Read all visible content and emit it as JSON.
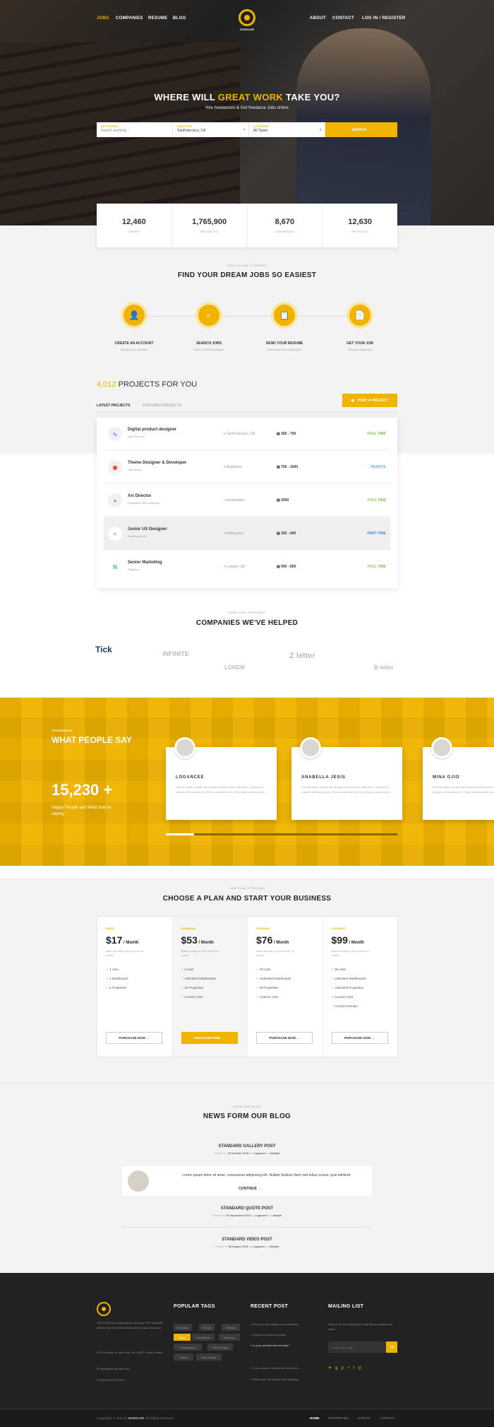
{
  "nav": {
    "items": [
      "JOBS",
      "COMPANIES",
      "RESUME",
      "BLOG"
    ],
    "right": [
      "ABOUT",
      "CONTACT",
      "LOG IN / REGISTER"
    ],
    "logo": "SCHOLAR"
  },
  "hero": {
    "title_a": "WHERE WILL ",
    "title_b": "GREAT WORK",
    "title_c": " TAKE YOU?",
    "subtitle": "Hire freelancers & Get freelance Jobs online"
  },
  "search": {
    "kw_label": "KEY WORDS",
    "kw_placeholder": "Search anything....",
    "loc_label": "LOCATION",
    "loc_value": "SanFrancisco, CA",
    "cat_label": "CATEGORY",
    "cat_value": "All Types",
    "button": "SEARCH →"
  },
  "stats": [
    {
      "value": "12,460",
      "label": "USERS"
    },
    {
      "value": "1,765,900",
      "label": "PROJECTS"
    },
    {
      "value": "8,670",
      "label": "COMPANIES"
    },
    {
      "value": "12,630",
      "label": "PROFILES"
    }
  ],
  "how": {
    "small": "THIS IS HOW IT WORKS",
    "title": "FIND YOUR DREAM JOBS SO EASIEST",
    "steps": [
      {
        "title": "CREATE AN ACCOUNT",
        "sub": "Become our member"
      },
      {
        "title": "SEARCH JOBS",
        "sub": "Over 1,765,900 projects"
      },
      {
        "title": "SEND YOUR RESUME",
        "sub": "Send resume to employers"
      },
      {
        "title": "GET YOUR JOB",
        "sub": "Get your dream job"
      }
    ]
  },
  "projects": {
    "count": "4,012",
    "title": " PROJECTS FOR YOU",
    "post_button": "POST A PROJECT",
    "tabs": [
      "LATEST PROJECTS",
      "FEATURED PROJECTS"
    ],
    "rows": [
      {
        "title": "Digital product designer",
        "company": "Alex Tech Inc",
        "location": "SanFrancisco, CA",
        "price": "350 - 750",
        "type": "FULL TIME",
        "type_color": "#8cc152"
      },
      {
        "title": "Theme Designer & Developer",
        "company": "XIM Studio",
        "location": "Anywhere",
        "price": "750 - 1000",
        "type": "REMOTE",
        "type_color": "#4fc1e9"
      },
      {
        "title": "Art Director",
        "company": "Pandora ELAN Company",
        "location": "Amsterdam",
        "price": "2000",
        "type": "FULL TIME",
        "type_color": "#8cc152"
      },
      {
        "title": "Junior UX Designer",
        "company": "ClearScore,UC",
        "location": "Melbourne",
        "price": "250 - 400",
        "type": "PART TIME",
        "type_color": "#4a89dc"
      },
      {
        "title": "Senior Marketing",
        "company": "PapyLinc",
        "location": "London, UK",
        "price": "500 - 800",
        "type": "FULL TIME",
        "type_color": "#8cc152"
      }
    ]
  },
  "partners": {
    "small": "SOME OUR PARTNERS",
    "title": "COMPANIES WE'VE HELPED",
    "logos": [
      "Tick",
      "INFINITE",
      "LOREM",
      "Z letter",
      "B letter"
    ]
  },
  "testimonials": {
    "small": "TESTIMONIALS",
    "title": "WHAT PEOPLE SAY",
    "count": "15,230 +",
    "count_sub": "Happy People and What they're saying",
    "cards": [
      {
        "name": "LOGANCEE",
        "text": "Sed elit quam, iaculis sed semper sit amet udin vitae nibh. Quisque at magna eleif semper eui. Fusce commodo elit Lorem ipsum dolor tuxma."
      },
      {
        "name": "ANABELLA JESIS",
        "text": "Sed elit quam, iaculis sed semper sit amet udin vitae nibh. Quisque at magna eleif semper eui. Fusce commodo elit Lorem ipsum dolor tuxma."
      },
      {
        "name": "MINA OJIO",
        "text": "Sed elit quam, iaculis sed semper sit amet udin vitae nibh. Quisque at magna eleif semper eui. Fusce commodo elit Lorem ipsum dolor tuxma."
      }
    ]
  },
  "pricing": {
    "small": "OUR PLAN & PRICING",
    "title": "CHOOSE A PLAN AND START YOUR BUSINESS",
    "button": "PURCHASE NOW →",
    "billed": "Billed anually or $19 month-to-month",
    "plans": [
      {
        "name": "BASIC",
        "price": "$17",
        "per": " / Month",
        "features": [
          "1 User",
          "1 Dashboard",
          "5 Properties"
        ]
      },
      {
        "name": "BUSINESS",
        "price": "$53",
        "per": " / Month",
        "features": [
          "3 User",
          "Unlimited Dashboards",
          "10 Properties",
          "Custom CSS"
        ]
      },
      {
        "name": "PREMIUM",
        "price": "$76",
        "per": " / Month",
        "features": [
          "20 User",
          "Unlimited Dashboards",
          "80 Properties",
          "Custom CSS"
        ]
      },
      {
        "name": "ULTIMATE",
        "price": "$99",
        "per": " / Month",
        "features": [
          "50 User",
          "Unlimited Dashboards",
          "Unlimited Properties",
          "Custom CSS",
          "Custom Domain"
        ]
      }
    ]
  },
  "blog": {
    "small": "FROM OUR BLOG",
    "title": "NEWS FORM OUR BLOG",
    "posted": "Posted on",
    "by": "by",
    "in": "in",
    "continue": "CONTINUE →",
    "excerpt": "Lorem ipsum dolor sit amet, consectetur adipiscing elit. Nullam facilisis diam sed tellus cursus, quis eleifend.",
    "posts": [
      {
        "title": "STANDARD GALLERY POST",
        "date": "25 October 2015",
        "author": "Logancee",
        "cat": "Lifestyle"
      },
      {
        "title": "STANDARD QUOTE POST",
        "date": "15 September 2015",
        "author": "Logancee",
        "cat": "Lifestyle"
      },
      {
        "title": "STANDARD VIDEO POST",
        "date": "06 August 2015",
        "author": "Logancee",
        "cat": "Lifestyle"
      }
    ]
  },
  "footer": {
    "about": "SCHOLAR is a multipurpose directory PSD Template which is the most perfect solution for your business.",
    "address": "79 Orchard St, New York, NY 10002, United States",
    "email": "hello@yourdomain.com",
    "phone": "(0091) 8547 632521",
    "tags_title": "POPULAR TAGS",
    "tags": [
      "Directory",
      "Envato",
      "Themes",
      "Clean",
      "WordPress",
      "Directory",
      "Photography",
      "Wimo Realty",
      "Twitter",
      "Real Estate"
    ],
    "recent_title": "RECENT POST",
    "recent": [
      "How you can impact your customers.",
      "Scholar is all about quality.",
      "Is your website user friendly ?",
      "Your customer should love your web.",
      "Make your site smooth and stunning."
    ],
    "mail_title": "MAILING LIST",
    "mail_text": "Sign up for our mailing list to get latest updates and offers.",
    "mail_placeholder": "Enter your email",
    "copyright_a": "Copyrights © 2015 by ",
    "copyright_b": "SCHOLAR",
    "copyright_c": ". All Rights Reserved",
    "links": [
      "HOME",
      "PROPERTIES",
      "AGENTS",
      "CONTACT"
    ]
  }
}
